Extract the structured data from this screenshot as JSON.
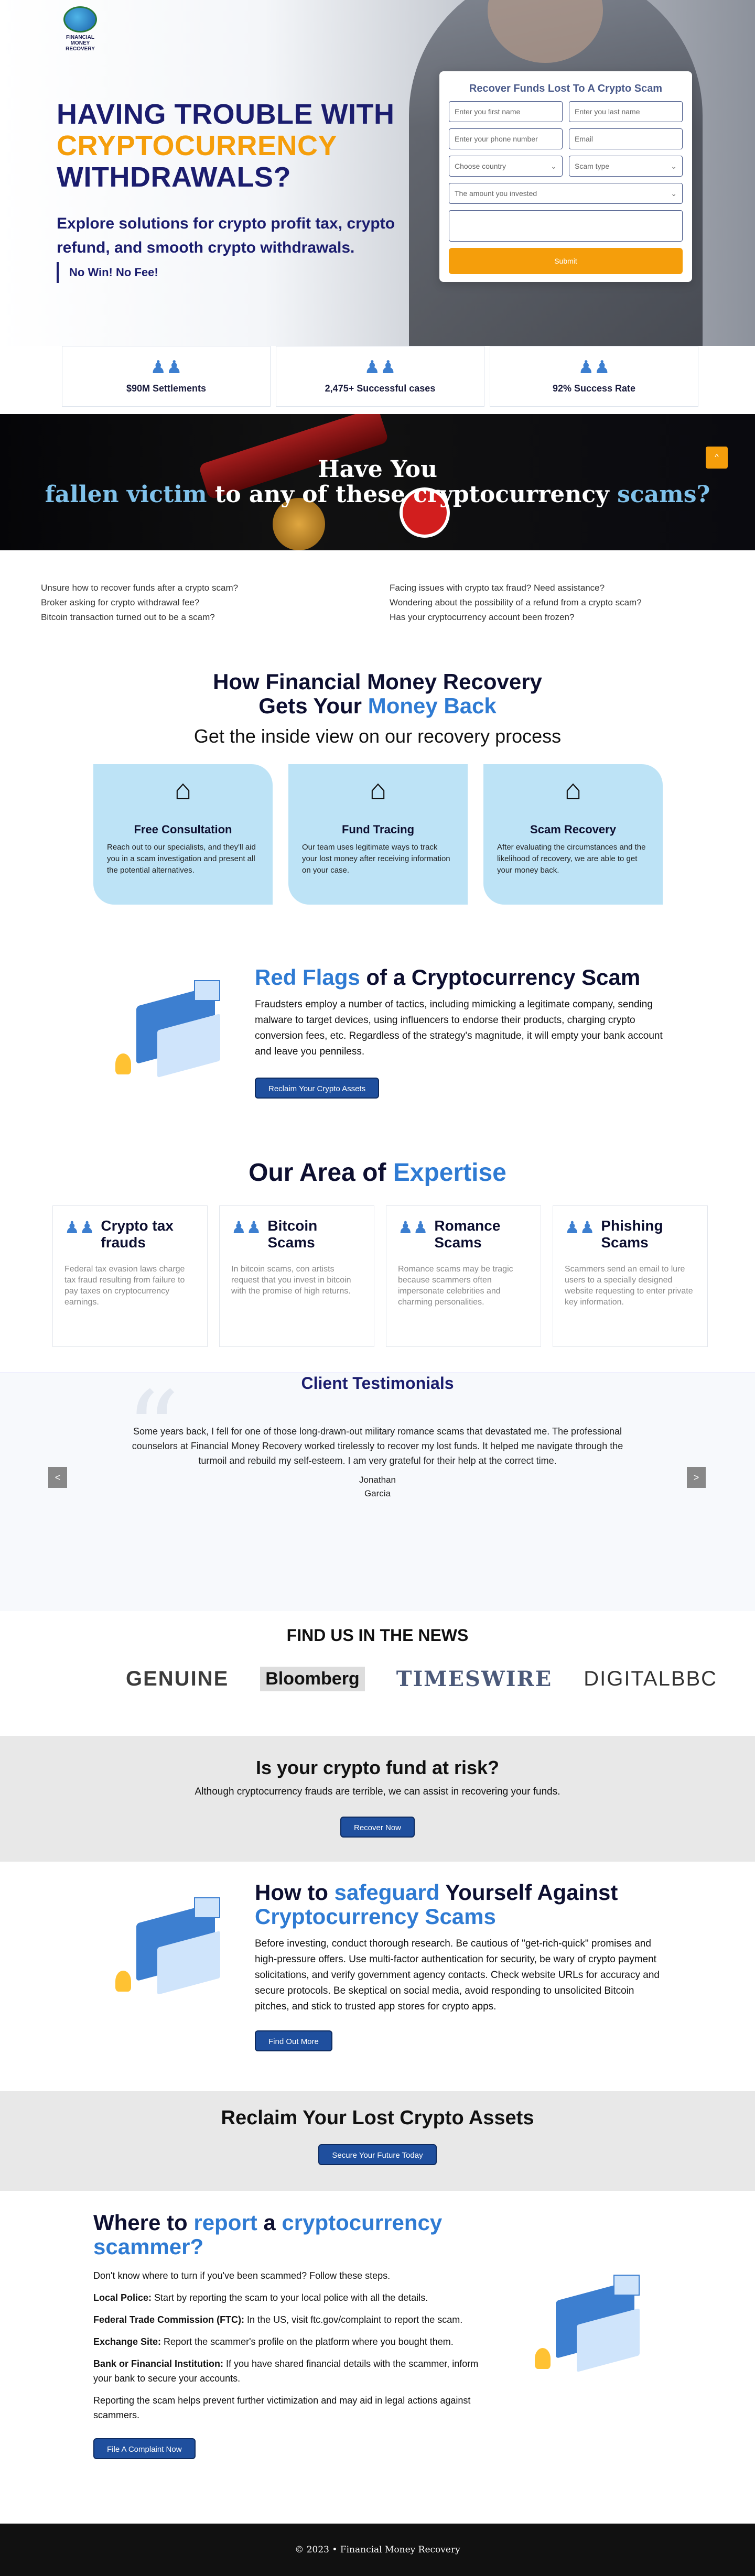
{
  "brand": {
    "logo_text": "FINANCIAL MONEY RECOVERY"
  },
  "hero": {
    "title_line1": "HAVING TROUBLE WITH",
    "title_line2": "CRYPTOCURRENCY",
    "title_line3": "WITHDRAWALS?",
    "subtitle": "Explore solutions for crypto profit tax, crypto refund, and smooth crypto withdrawals.",
    "tagline": "No Win! No Fee!"
  },
  "form": {
    "title": "Recover Funds Lost To A Crypto Scam",
    "first_name_ph": "Enter you first name",
    "last_name_ph": "Enter you last name",
    "phone_ph": "Enter your phone number",
    "email_ph": "Email",
    "country": "Choose country",
    "scam_type": "Scam type",
    "amount": "The amount you invested",
    "submit": "Submit"
  },
  "stats": [
    {
      "label": "$90M Settlements"
    },
    {
      "label": "2,475+ Successful cases"
    },
    {
      "label": "92% Success Rate"
    }
  ],
  "banner": {
    "line1": "Have You",
    "line2a": "fallen victim",
    "line2b": " to any of these cryptocurrency ",
    "line2c": "scams?",
    "up": "^"
  },
  "questions": {
    "left": [
      "Unsure how to recover funds after a crypto scam?",
      "Broker asking for crypto withdrawal fee?",
      "Bitcoin transaction turned out to be a scam?"
    ],
    "right": [
      "Facing issues with crypto tax fraud? Need assistance?",
      "Wondering about the possibility of a refund from a crypto scam?",
      "Has your cryptocurrency account been frozen?"
    ]
  },
  "process": {
    "title1": "How Financial Money Recovery",
    "title2a": "Gets Your ",
    "title2b": "Money Back",
    "subtitle": "Get the inside view on our recovery process",
    "cards": [
      {
        "title": "Free Consultation",
        "text": "Reach out to our specialists, and they'll aid you in a scam investigation and present all the potential alternatives."
      },
      {
        "title": "Fund Tracing",
        "text": "Our team uses legitimate ways to track your lost money after receiving information on your case."
      },
      {
        "title": "Scam Recovery",
        "text": "After evaluating the circumstances and the likelihood of recovery, we are able to get your money back."
      }
    ]
  },
  "redflags": {
    "title_a": "Red Flags",
    "title_b": " of a Cryptocurrency Scam",
    "text": "Fraudsters employ a number of tactics, including mimicking a legitimate company, sending malware to target devices, using influencers to endorse their products, charging crypto conversion fees, etc. Regardless of the strategy's magnitude, it will empty your bank account and leave you penniless.",
    "button": "Reclaim Your Crypto Assets"
  },
  "expertise": {
    "title_a": "Our Area of ",
    "title_b": "Expertise",
    "items": [
      {
        "title": "Crypto tax frauds",
        "text": "Federal tax evasion laws charge tax fraud resulting from failure to pay taxes on cryptocurrency earnings."
      },
      {
        "title": "Bitcoin Scams",
        "text": "In bitcoin scams, con artists request that you invest in bitcoin with the promise of high returns."
      },
      {
        "title": "Romance Scams",
        "text": "Romance scams may be tragic because scammers often impersonate celebrities and charming personalities."
      },
      {
        "title": "Phishing Scams",
        "text": "Scammers send an email to lure users to a specially designed website requesting to enter private key information."
      }
    ]
  },
  "testimonials": {
    "title": "Client Testimonials",
    "text": "Some years back, I fell for one of those long-drawn-out military romance scams that devastated me. The professional counselors at Financial Money Recovery worked tirelessly to recover my lost funds. It helped me navigate through the turmoil and rebuild my self-esteem. I am very grateful for their help at the correct time.",
    "name1": "Jonathan",
    "name2": "Garcia",
    "prev": "<",
    "next": ">"
  },
  "news": {
    "title": "FIND US IN THE NEWS",
    "logos": [
      "GENUINE",
      "Bloomberg",
      "TIMESWIRE",
      "DIGITALBBC"
    ]
  },
  "risk": {
    "title": "Is your crypto fund at risk?",
    "text": "Although cryptocurrency frauds are terrible, we can assist in recovering your funds.",
    "button": "Recover Now"
  },
  "safeguard": {
    "title_a": "How to ",
    "title_b": "safeguard",
    "title_c": " Yourself Against ",
    "title_d": "Cryptocurrency Scams",
    "text": "Before investing, conduct thorough research. Be cautious of \"get-rich-quick\" promises and high-pressure offers. Use multi-factor authentication for security, be wary of crypto payment solicitations, and verify government agency contacts. Check website URLs for accuracy and secure protocols. Be skeptical on social media, avoid responding to unsolicited Bitcoin pitches, and stick to trusted app stores for crypto apps.",
    "button": "Find Out More"
  },
  "reclaim": {
    "title": "Reclaim Your Lost Crypto Assets",
    "button": "Secure Your Future Today"
  },
  "report": {
    "title_a": "Where to ",
    "title_b": "report",
    "title_c": " a ",
    "title_d": "cryptocurrency scammer?",
    "intro": "Don't know where to turn if you've been scammed? Follow these steps.",
    "items": [
      {
        "label": "Local Police:",
        "text": " Start by reporting the scam to your local police with all the details."
      },
      {
        "label": "Federal Trade Commission (FTC):",
        "text": " In the US, visit ftc.gov/complaint to report the scam."
      },
      {
        "label": "Exchange Site:",
        "text": " Report the scammer's profile on the platform where you bought them."
      },
      {
        "label": "Bank or Financial Institution:",
        "text": " If you have shared financial details with the scammer, inform your bank to secure your accounts."
      }
    ],
    "outro": "Reporting the scam helps prevent further victimization and may aid in legal actions against scammers.",
    "button": "File A Complaint Now"
  },
  "footer": {
    "text": "© 2023 • Financial Money Recovery"
  }
}
